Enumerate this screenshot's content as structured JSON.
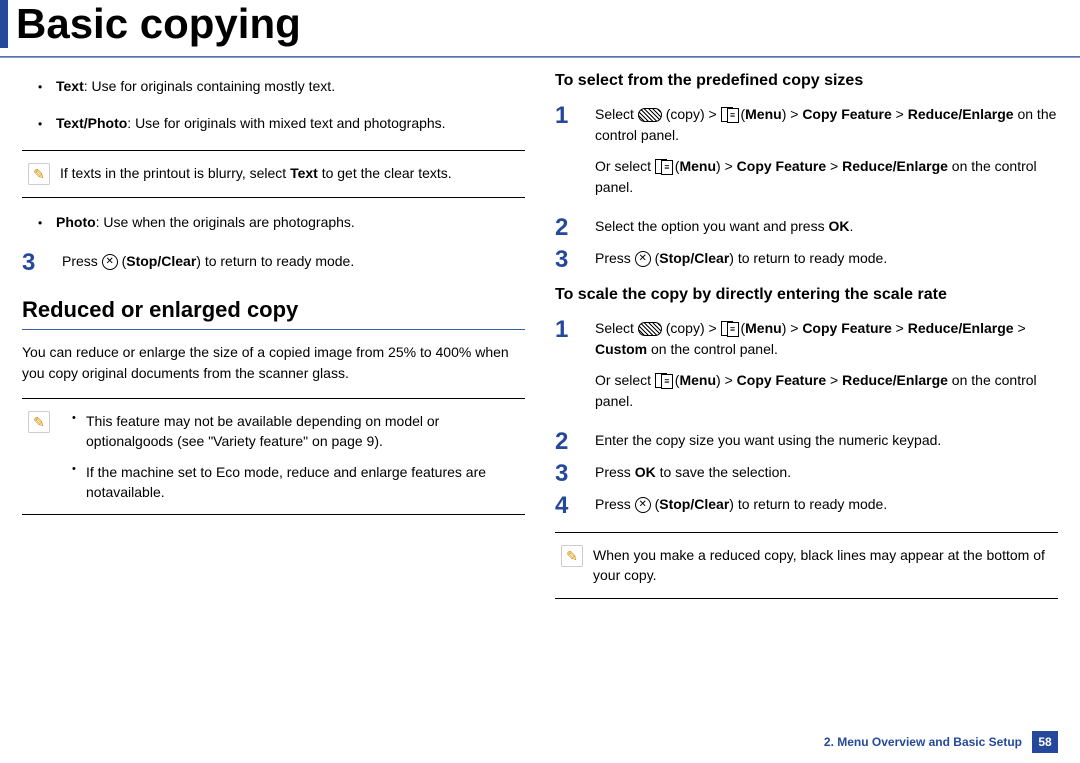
{
  "title": "Basic copying",
  "leftCol": {
    "bullets1": [
      {
        "bold": "Text",
        "rest": ": Use for originals containing mostly text."
      },
      {
        "bold": "Text/Photo",
        "rest": ": Use for originals with mixed text and photographs."
      }
    ],
    "note1": {
      "pre": "If texts in the printout is blurry, select ",
      "bold": "Text",
      "post": " to get the clear texts."
    },
    "bullets2": [
      {
        "bold": "Photo",
        "rest": ": Use when the originals are photographs."
      }
    ],
    "step3": {
      "num": "3",
      "pre": "Press ",
      "iconLabel": "Stop/Clear",
      "post": ") to return to ready mode."
    },
    "h2": "Reduced or enlarged copy",
    "body": "You can reduce or enlarge the size of a copied image from 25% to 400% when you copy original documents from the scanner glass.",
    "note2": {
      "items": [
        "This feature may not be available depending on model or optionalgoods (see \"Variety feature\" on page 9).",
        "If the machine set to Eco mode, reduce and enlarge features are notavailable."
      ]
    }
  },
  "rightCol": {
    "h3a": "To select from the predefined copy sizes",
    "stepsA": [
      {
        "num": "1",
        "p1_pre": "Select ",
        "p1_copy": "(copy) > ",
        "p1_menu": "(",
        "p1_menuBold": "Menu",
        "p1_midBold": ") > ",
        "p1_bold2": "Copy Feature",
        "p1_s1": " > ",
        "p1_bold3": "Reduce/Enlarge",
        "p1_post": " on the control panel.",
        "p2_pre": "Or select ",
        "p2_menu": "(",
        "p2_menuBold": "Menu",
        "p2_midBold": ") > ",
        "p2_bold2": "Copy Feature",
        "p2_s1": " > ",
        "p2_bold3": "Reduce/Enlarge",
        "p2_post": " on the control panel."
      },
      {
        "num": "2",
        "text_pre": "Select the option you want and press ",
        "text_bold": "OK",
        "text_post": "."
      },
      {
        "num": "3",
        "pre": "Press ",
        "iconLabel": "Stop/Clear",
        "post": ") to return to ready mode."
      }
    ],
    "h3b": "To scale the copy by directly entering the scale rate",
    "stepsB": [
      {
        "num": "1",
        "p1_pre": "Select ",
        "p1_copy": "(copy) > ",
        "p1_menu": "(",
        "p1_menuBold": "Menu",
        "p1_midBold": ") > ",
        "p1_bold2": "Copy Feature",
        "p1_s1": " > ",
        "p1_bold3": "Reduce/Enlarge",
        "p1_s2": " > ",
        "p1_bold4": "Custom",
        "p1_post": " on the control panel.",
        "p2_pre": "Or select ",
        "p2_menu": "(",
        "p2_menuBold": "Menu",
        "p2_midBold": ") > ",
        "p2_bold2": "Copy Feature",
        "p2_s1": " > ",
        "p2_bold3": "Reduce/Enlarge",
        "p2_post": " on the control panel."
      },
      {
        "num": "2",
        "plain": "Enter the copy size you want using the numeric keypad."
      },
      {
        "num": "3",
        "text_pre": "Press ",
        "text_bold": "OK",
        "text_post": " to save the selection."
      },
      {
        "num": "4",
        "pre": "Press ",
        "iconLabel": "Stop/Clear",
        "post": ") to return to ready mode."
      }
    ],
    "note3": "When you make a reduced copy, black lines may appear at the bottom of your copy."
  },
  "footer": {
    "chapter": "2. Menu Overview and Basic Setup",
    "page": "58"
  }
}
